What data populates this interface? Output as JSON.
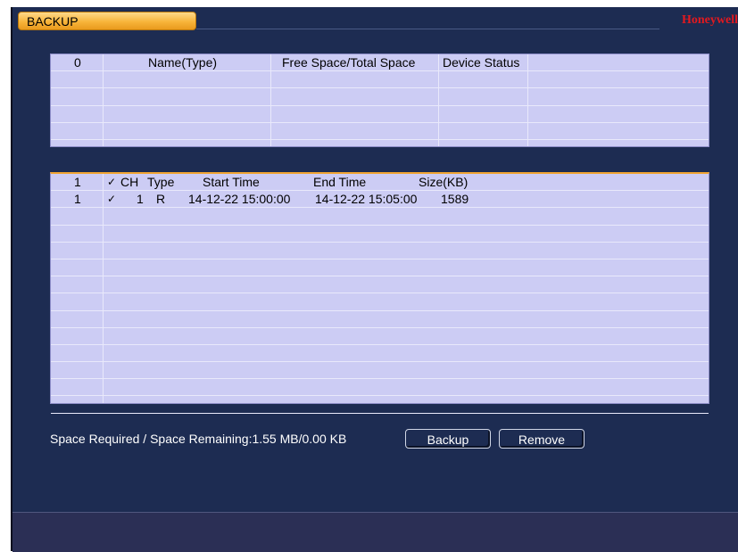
{
  "header": {
    "title": "BACKUP",
    "brand": "Honeywell"
  },
  "device_table": {
    "header": {
      "index": "0",
      "name": "Name(Type)",
      "space": "Free Space/Total Space",
      "status": "Device Status"
    },
    "rows": []
  },
  "file_table": {
    "header": {
      "index": "1",
      "check": "✓",
      "ch": "CH",
      "type": "Type",
      "start": "Start Time",
      "end": "End Time",
      "size": "Size(KB)"
    },
    "rows": [
      {
        "index": "1",
        "check": "✓",
        "ch": "1",
        "type": "R",
        "start": "14-12-22 15:00:00",
        "end": "14-12-22 15:05:00",
        "size": "1589"
      }
    ]
  },
  "status": {
    "label": "Space Required / Space Remaining:1.55 MB/0.00 KB"
  },
  "buttons": {
    "backup": "Backup",
    "remove": "Remove"
  },
  "colors": {
    "background": "#1d2c52",
    "table_bg": "#ccccf4",
    "accent_orange": "#f7b43a",
    "brand_red": "#e2191f"
  }
}
